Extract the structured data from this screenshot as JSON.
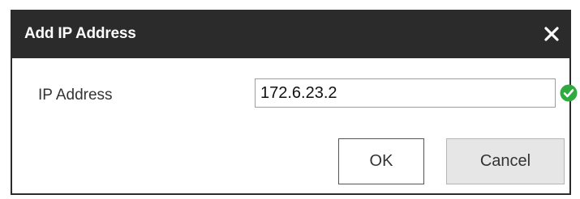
{
  "dialog": {
    "title": "Add IP Address",
    "close_icon": "close-icon"
  },
  "form": {
    "ip_label": "IP Address",
    "ip_value": "172.6.23.2",
    "valid_icon": "check-circle-icon"
  },
  "buttons": {
    "ok_label": "OK",
    "cancel_label": "Cancel"
  },
  "colors": {
    "titlebar": "#2b2b2b",
    "valid": "#2eaa3f"
  }
}
